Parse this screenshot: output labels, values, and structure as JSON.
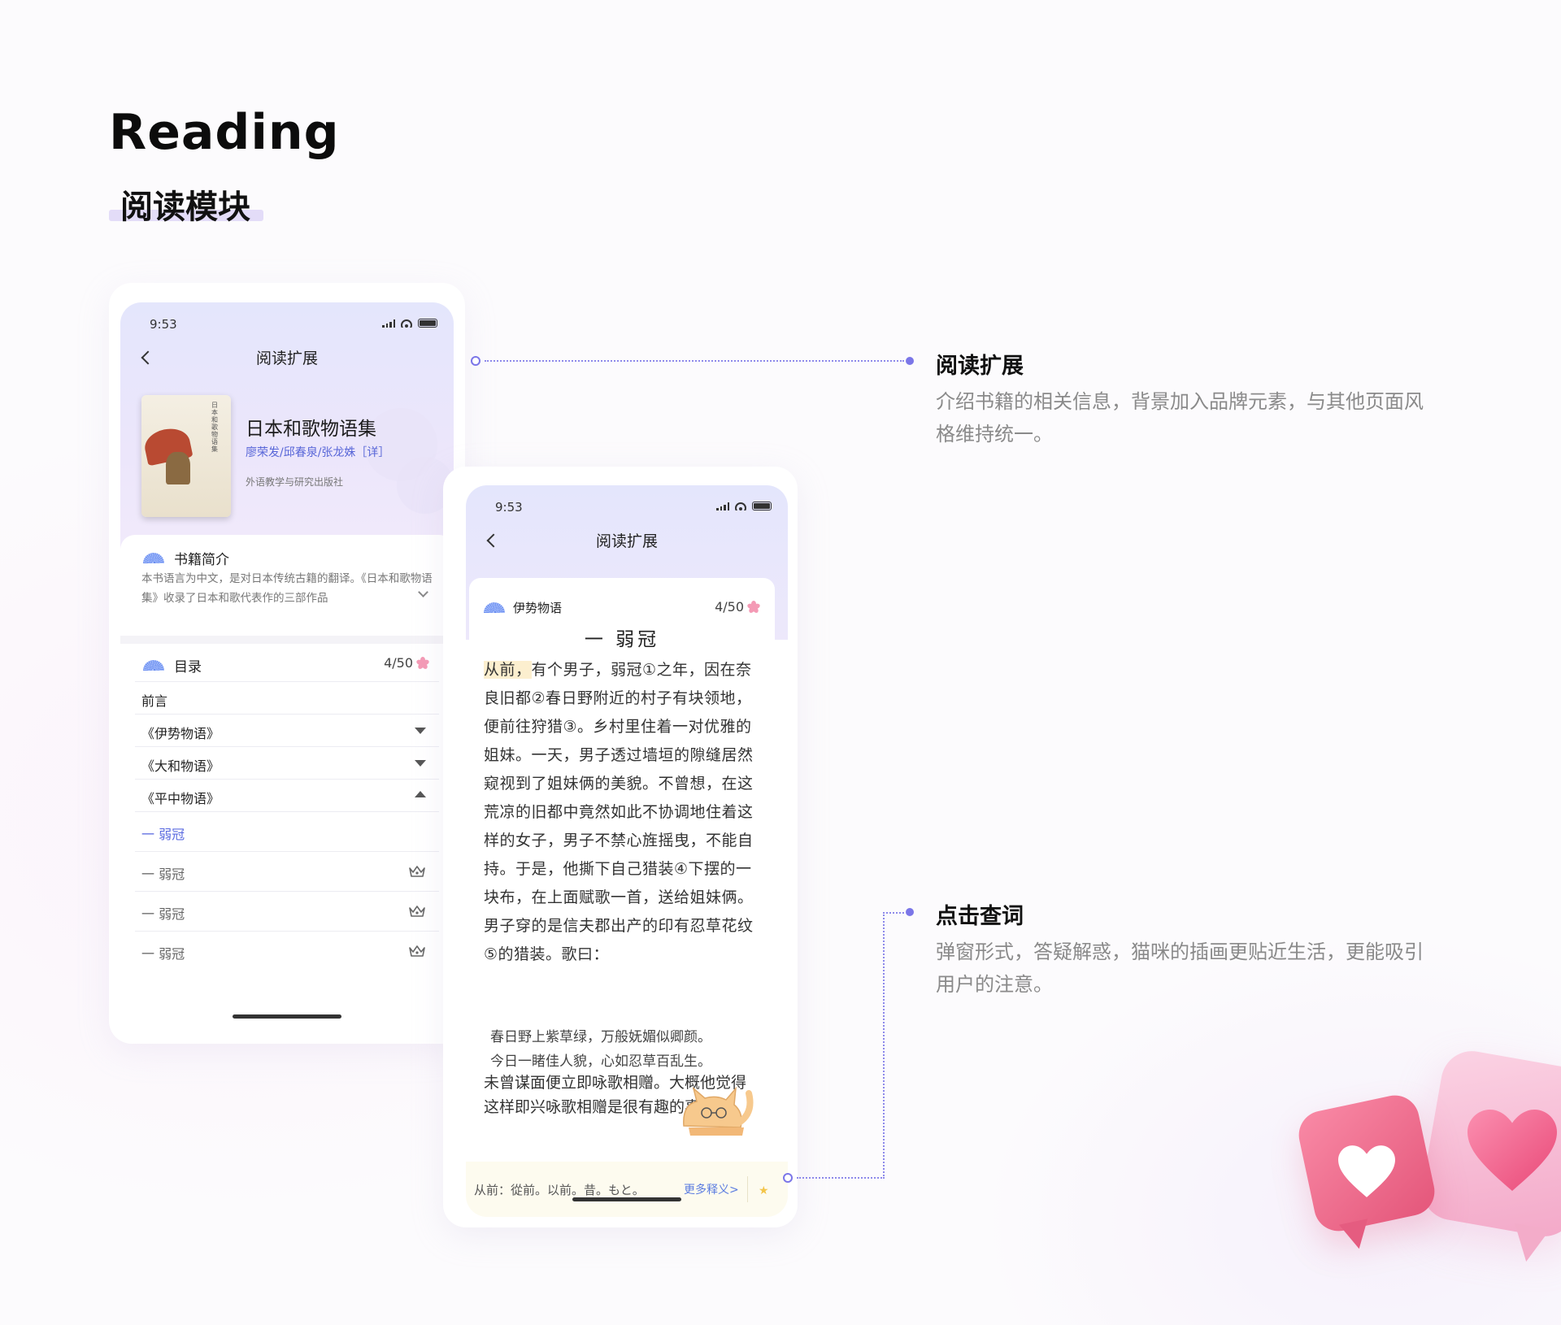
{
  "header": {
    "title": "Reading",
    "subtitle": "阅读模块"
  },
  "phone_left": {
    "time": "9:53",
    "nav_title": "阅读扩展",
    "book": {
      "cover_text": "日本和歌物语集",
      "title": "日本和歌物语集",
      "authors": "廖荣发/邱春泉/张龙姝［详］",
      "publisher": "外语教学与研究出版社"
    },
    "intro": {
      "heading": "书籍简介",
      "text": "本书语言为中文，是对日本传统古籍的翻译。《日本和歌物语集》收录了日本和歌代表作的三部作品"
    },
    "toc": {
      "heading": "目录",
      "count": "4/50",
      "rows": [
        {
          "label": "前言"
        },
        {
          "label": "《伊势物语》"
        },
        {
          "label": "《大和物语》"
        },
        {
          "label": "《平中物语》"
        }
      ],
      "chapters": [
        {
          "label": "一  弱冠"
        },
        {
          "label": "一  弱冠"
        },
        {
          "label": "一  弱冠"
        },
        {
          "label": "一  弱冠"
        }
      ]
    }
  },
  "phone_right": {
    "time": "9:53",
    "nav_title": "阅读扩展",
    "book_name": "伊势物语",
    "count": "4/50",
    "chapter_title": "一  弱冠",
    "highlight": "从前，",
    "paragraph": "有个男子，弱冠①之年，因在奈良旧都②春日野附近的村子有块领地，便前往狩猎③。乡村里住着一对优雅的姐妹。一天，男子透过墙垣的隙缝居然窥视到了姐妹俩的美貌。不曾想，在这荒凉的旧都中竟然如此不协调地住着这样的女子，男子不禁心旌摇曳，不能自持。于是，他撕下自己猎装④下摆的一块布，在上面赋歌一首，送给姐妹俩。男子穿的是信夫郡出产的印有忍草花纹⑤的猎装。歌曰：",
    "poem": [
      "春日野上紫草绿，万般妩媚似卿颜。",
      "今日一睹佳人貌，心如忍草百乱生。"
    ],
    "paragraph2": "未曾谋面便立即咏歌相赠。大概他觉得这样即兴咏歌相赠是很有趣的事",
    "popup": {
      "definition": "从前：從前。以前。昔。もと。",
      "more": "更多释义>"
    }
  },
  "annotations": [
    {
      "title": "阅读扩展",
      "desc": "介绍书籍的相关信息，背景加入品牌元素，与其他页面风格维持统一。"
    },
    {
      "title": "点击查词",
      "desc": "弹窗形式，答疑解惑，猫咪的插画更贴近生活，更能吸引用户的注意。"
    }
  ],
  "colors": {
    "accent": "#7b76e8",
    "link": "#5b6be0",
    "highlight": "#fcefcf",
    "popup_bg": "#fdfbef"
  },
  "icons": [
    "back-arrow-icon",
    "signal-icon",
    "wifi-icon",
    "battery-icon",
    "fan-icon",
    "sakura-icon",
    "crown-icon",
    "star-icon",
    "heart-icon",
    "cat-illustration"
  ]
}
